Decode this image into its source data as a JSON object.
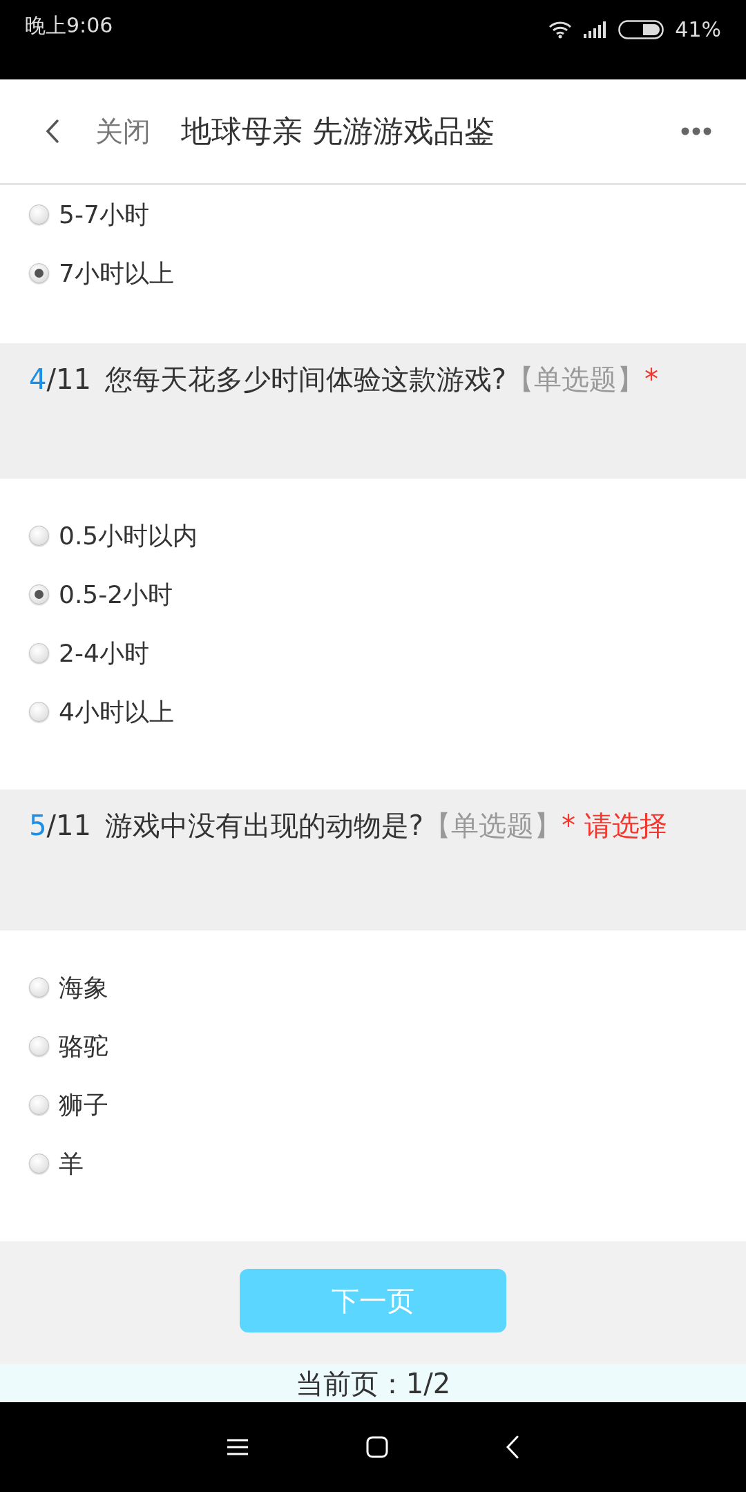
{
  "status_bar": {
    "time": "晚上9:06",
    "battery": "41%"
  },
  "header": {
    "close": "关闭",
    "title": "地球母亲 先游游戏品鉴"
  },
  "questions": [
    {
      "options": [
        {
          "label": "5-7小时",
          "selected": false
        },
        {
          "label": "7小时以上",
          "selected": true
        }
      ]
    },
    {
      "number": "4",
      "total": "/11",
      "text": "您每天花多少时间体验这款游戏?",
      "type": "【单选题】",
      "required": "*",
      "options": [
        {
          "label": "0.5小时以内",
          "selected": false
        },
        {
          "label": "0.5-2小时",
          "selected": true
        },
        {
          "label": "2-4小时",
          "selected": false
        },
        {
          "label": "4小时以上",
          "selected": false
        }
      ]
    },
    {
      "number": "5",
      "total": "/11",
      "text": "游戏中没有出现的动物是?",
      "type": "【单选题】",
      "required": "*",
      "warning": "请选择",
      "options": [
        {
          "label": "海象",
          "selected": false
        },
        {
          "label": "骆驼",
          "selected": false
        },
        {
          "label": "狮子",
          "selected": false
        },
        {
          "label": "羊",
          "selected": false
        }
      ]
    }
  ],
  "next_button": "下一页",
  "page_indicator": "当前页：1/2"
}
